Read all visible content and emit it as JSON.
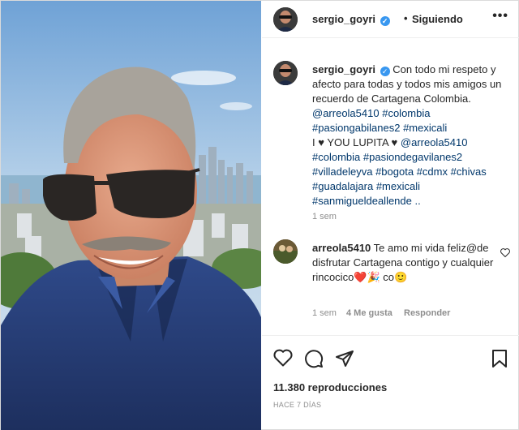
{
  "header": {
    "username": "sergio_goyri",
    "verified_glyph": "✓",
    "separator": "•",
    "follow_label": "Siguiendo",
    "more_label": "•••"
  },
  "caption": {
    "username": "sergio_goyri",
    "text_lines": [
      "Con todo mi respeto y afecto para todas y todos mis amigos un recuerdo de Cartagena Colombia."
    ],
    "mention1": "@arreola5410",
    "tag_colombia": "#colombia",
    "tag_pasiongabilanes2": "#pasiongabilanes2",
    "tag_mexicali": "#mexicali",
    "love_text": "I ♥ YOU LUPITA ♥",
    "mention2": "@arreola5410",
    "tag_colombia2": "#colombia",
    "tag_pasiondegavilanes2": "#pasiondegavilanes2",
    "tag_villadeleyva": "#villadeleyva",
    "tag_bogota": "#bogota",
    "tag_cdmx": "#cdmx",
    "tag_chivas": "#chivas",
    "tag_guadalajara": "#guadalajara",
    "tag_mexicali2": "#mexicali",
    "tag_sanmiguel": "#sanmigueldeallende",
    "ellipsis": "..",
    "time": "1 sem"
  },
  "comment": {
    "username": "arreola5410",
    "text": "Te amo mi vida feliz@de disfrutar Cartagena contigo y cualquier rincocico",
    "emoji_heart": "❤️",
    "emoji_party": "🎉",
    "trailing": "co",
    "emoji_smile": "🙂",
    "time": "1 sem",
    "likes": "4 Me gusta",
    "reply_label": "Responder"
  },
  "stats": {
    "views": "11.380 reproducciones",
    "date": "HACE 7 DÍAS"
  },
  "icons": {
    "like": "heart-icon",
    "comment": "comment-icon",
    "share": "share-icon",
    "save": "bookmark-icon"
  },
  "colors": {
    "link": "#00376b",
    "verified": "#3897f0",
    "meta": "#8e8e8e"
  }
}
